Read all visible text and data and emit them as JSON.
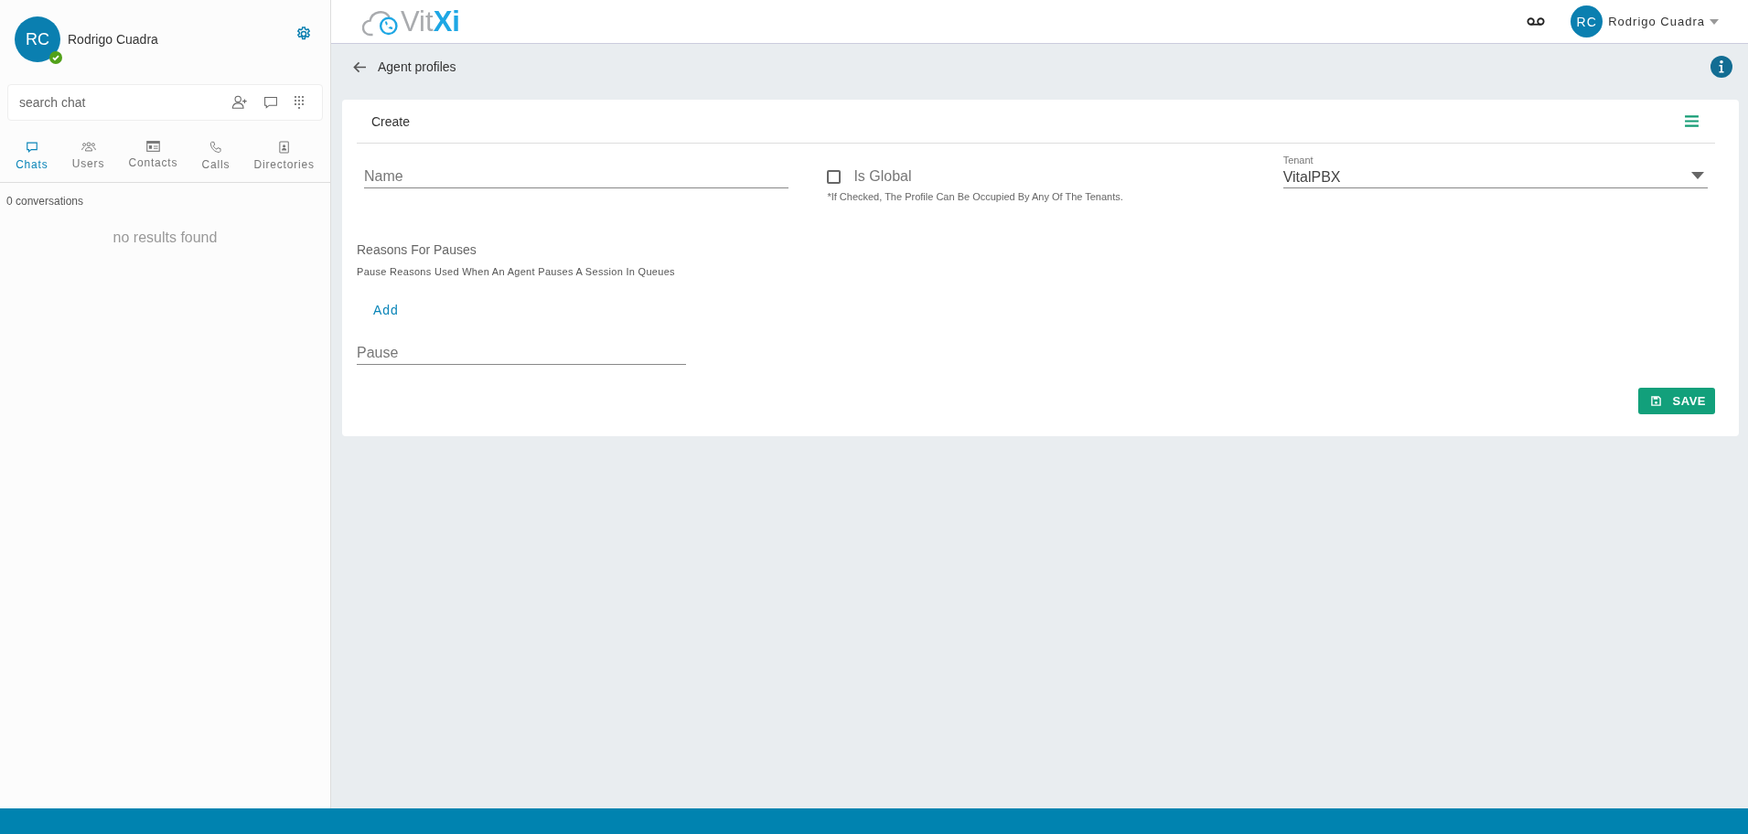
{
  "sidebar": {
    "user": {
      "initials": "RC",
      "name": "Rodrigo Cuadra",
      "online": true
    },
    "search": {
      "placeholder": "search chat"
    },
    "tabs": [
      {
        "kind": "chat",
        "label": "Chats",
        "selected": true
      },
      {
        "kind": "users",
        "label": "Users",
        "selected": false
      },
      {
        "kind": "contacts",
        "label": "Contacts",
        "selected": false
      },
      {
        "kind": "calls",
        "label": "Calls",
        "selected": false
      },
      {
        "kind": "directories",
        "label": "Directories",
        "selected": false
      }
    ],
    "count": "0 conversations",
    "empty": "no results found"
  },
  "topbar": {
    "logo": {
      "text": "Vit",
      "accent": "Xi"
    },
    "user": {
      "initials": "RC",
      "name": "Rodrigo Cuadra"
    }
  },
  "page": {
    "title": "Agent profiles",
    "card": {
      "title": "Create",
      "name_field": {
        "placeholder": "Name"
      },
      "global": {
        "label": "Is Global",
        "checked": false,
        "hint": "*If Checked, The Profile Can Be Occupied By Any Of The Tenants."
      },
      "tenant": {
        "label": "Tenant",
        "value": "VitalPBX"
      },
      "reasons": {
        "title": "Reasons For Pauses",
        "description": "Pause Reasons Used When An Agent Pauses A Session In Queues",
        "add": "Add",
        "pause_field": {
          "placeholder": "Pause"
        }
      },
      "save": "SAVE"
    }
  }
}
